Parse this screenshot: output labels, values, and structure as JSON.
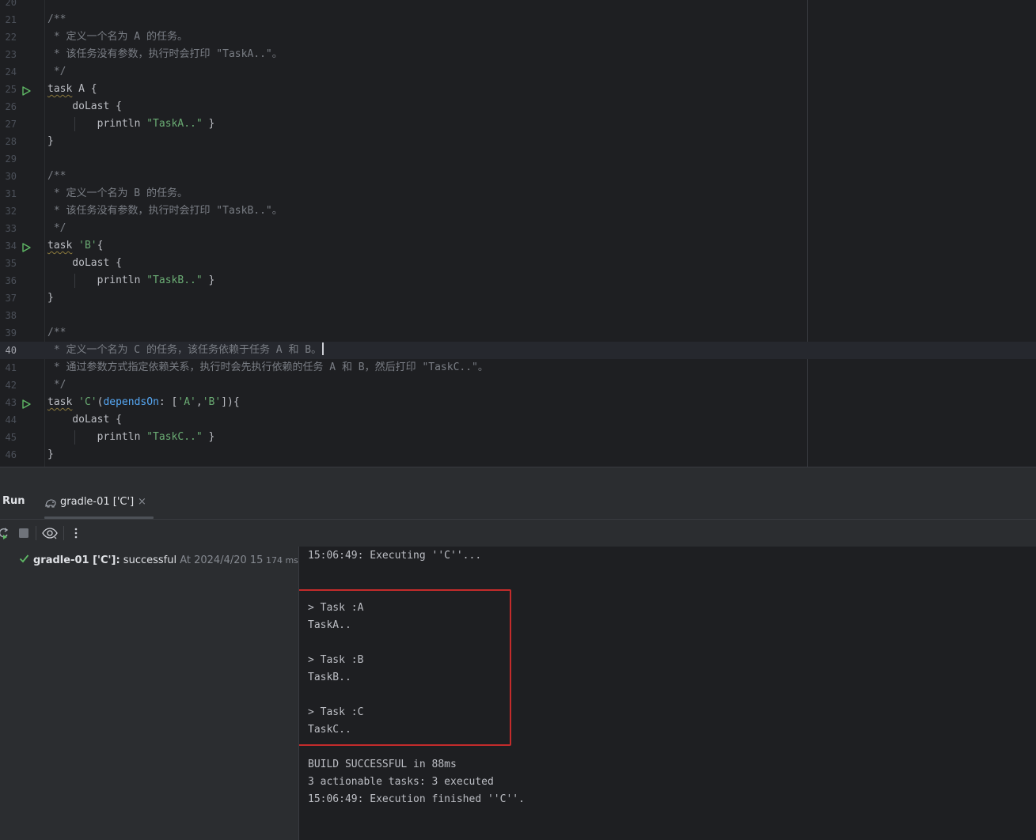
{
  "editor": {
    "current_line": 40,
    "lines": [
      {
        "no": "20",
        "tokens": []
      },
      {
        "no": "21",
        "tokens": [
          {
            "t": "/**",
            "c": "c"
          }
        ]
      },
      {
        "no": "22",
        "tokens": [
          {
            "t": " * 定义一个名为 A 的任务。",
            "c": "c"
          }
        ]
      },
      {
        "no": "23",
        "tokens": [
          {
            "t": " * 该任务没有参数，执行时会打印 \"TaskA..\"。",
            "c": "c"
          }
        ]
      },
      {
        "no": "24",
        "tokens": [
          {
            "t": " */",
            "c": "c"
          }
        ]
      },
      {
        "no": "25",
        "run": true,
        "tokens": [
          {
            "t": "task",
            "c": "k"
          },
          {
            "t": " A {",
            "c": "p"
          }
        ]
      },
      {
        "no": "26",
        "tokens": [
          {
            "t": "    doLast {",
            "c": "p"
          }
        ]
      },
      {
        "no": "27",
        "tokens": [
          {
            "t": "        println ",
            "c": "p"
          },
          {
            "t": "\"TaskA..\"",
            "c": "s"
          },
          {
            "t": " }",
            "c": "p"
          }
        ]
      },
      {
        "no": "28",
        "tokens": [
          {
            "t": "}",
            "c": "p"
          }
        ]
      },
      {
        "no": "29",
        "tokens": []
      },
      {
        "no": "30",
        "tokens": [
          {
            "t": "/**",
            "c": "c"
          }
        ]
      },
      {
        "no": "31",
        "tokens": [
          {
            "t": " * 定义一个名为 B 的任务。",
            "c": "c"
          }
        ]
      },
      {
        "no": "32",
        "tokens": [
          {
            "t": " * 该任务没有参数，执行时会打印 \"TaskB..\"。",
            "c": "c"
          }
        ]
      },
      {
        "no": "33",
        "tokens": [
          {
            "t": " */",
            "c": "c"
          }
        ]
      },
      {
        "no": "34",
        "run": true,
        "tokens": [
          {
            "t": "task",
            "c": "k"
          },
          {
            "t": " ",
            "c": "p"
          },
          {
            "t": "'B'",
            "c": "s"
          },
          {
            "t": "{",
            "c": "p"
          }
        ]
      },
      {
        "no": "35",
        "tokens": [
          {
            "t": "    doLast {",
            "c": "p"
          }
        ]
      },
      {
        "no": "36",
        "tokens": [
          {
            "t": "        println ",
            "c": "p"
          },
          {
            "t": "\"TaskB..\"",
            "c": "s"
          },
          {
            "t": " }",
            "c": "p"
          }
        ]
      },
      {
        "no": "37",
        "tokens": [
          {
            "t": "}",
            "c": "p"
          }
        ]
      },
      {
        "no": "38",
        "tokens": []
      },
      {
        "no": "39",
        "tokens": [
          {
            "t": "/**",
            "c": "c"
          }
        ]
      },
      {
        "no": "40",
        "caret": true,
        "tokens": [
          {
            "t": " * 定义一个名为 C 的任务，该任务依赖于任务 A 和 B。",
            "c": "c"
          }
        ]
      },
      {
        "no": "41",
        "tokens": [
          {
            "t": " * 通过参数方式指定依赖关系，执行时会先执行依赖的任务 A 和 B，然后打印 \"TaskC..\"。",
            "c": "c"
          }
        ]
      },
      {
        "no": "42",
        "tokens": [
          {
            "t": " */",
            "c": "c"
          }
        ]
      },
      {
        "no": "43",
        "run": true,
        "tokens": [
          {
            "t": "task",
            "c": "k"
          },
          {
            "t": " ",
            "c": "p"
          },
          {
            "t": "'C'",
            "c": "s"
          },
          {
            "t": "(",
            "c": "p"
          },
          {
            "t": "dependsOn",
            "c": "n"
          },
          {
            "t": ": [",
            "c": "p"
          },
          {
            "t": "'A'",
            "c": "s"
          },
          {
            "t": ",",
            "c": "p"
          },
          {
            "t": "'B'",
            "c": "s"
          },
          {
            "t": "]){",
            "c": "p"
          }
        ]
      },
      {
        "no": "44",
        "tokens": [
          {
            "t": "    doLast {",
            "c": "p"
          }
        ]
      },
      {
        "no": "45",
        "tokens": [
          {
            "t": "        println ",
            "c": "p"
          },
          {
            "t": "\"TaskC..\"",
            "c": "s"
          },
          {
            "t": " }",
            "c": "p"
          }
        ]
      },
      {
        "no": "46",
        "tokens": [
          {
            "t": "}",
            "c": "p"
          }
        ]
      }
    ]
  },
  "run_panel": {
    "title": "Run",
    "tab_label": "gradle-01 ['C']",
    "tab_close": "×",
    "tree": {
      "name": "gradle-01 ['C']:",
      "status": " successful",
      "time": " At 2024/4/20 15",
      "duration": " 174 ms"
    },
    "console_lines": [
      "15:06:49: Executing ''C''...",
      "",
      "",
      "> Task :A",
      "TaskA..",
      "",
      "> Task :B",
      "TaskB..",
      "",
      "> Task :C",
      "TaskC..",
      "",
      "BUILD SUCCESSFUL in 88ms",
      "3 actionable tasks: 3 executed",
      "15:06:49: Execution finished ''C''."
    ]
  },
  "colors": {
    "comment": "#7a7e85",
    "string": "#6aab73",
    "named_arg": "#56a8f5",
    "run_icon": "#5fb865",
    "highlight_box": "#c42b2b"
  }
}
